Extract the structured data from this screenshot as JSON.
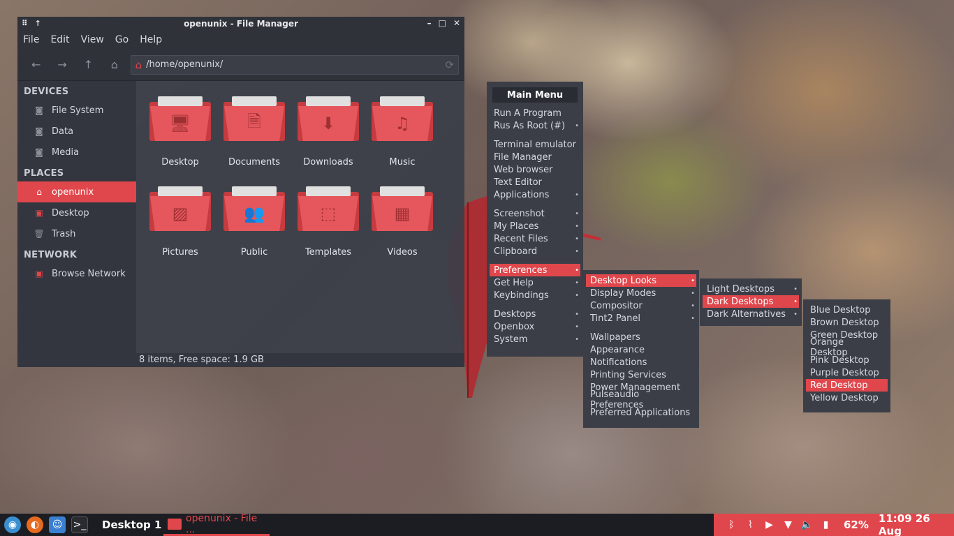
{
  "window": {
    "title": "openunix - File Manager",
    "menu": [
      "File",
      "Edit",
      "View",
      "Go",
      "Help"
    ],
    "path": "/home/openunix/",
    "status": "8 items, Free space: 1.9 GB"
  },
  "sidebar": {
    "devices_label": "DEVICES",
    "devices": [
      "File System",
      "Data",
      "Media"
    ],
    "places_label": "PLACES",
    "places": [
      "openunix",
      "Desktop",
      "Trash"
    ],
    "network_label": "NETWORK",
    "network": [
      "Browse Network"
    ]
  },
  "folders": [
    {
      "name": "Desktop",
      "icon": "desktop-icon"
    },
    {
      "name": "Documents",
      "icon": "document-icon"
    },
    {
      "name": "Downloads",
      "icon": "download-icon"
    },
    {
      "name": "Music",
      "icon": "music-icon"
    },
    {
      "name": "Pictures",
      "icon": "image-icon"
    },
    {
      "name": "Public",
      "icon": "people-icon"
    },
    {
      "name": "Templates",
      "icon": "template-icon"
    },
    {
      "name": "Videos",
      "icon": "film-icon"
    }
  ],
  "main_menu": {
    "title": "Main Menu",
    "items": [
      "Run A Program",
      "Rus As Root (#)",
      "Terminal emulator",
      "File Manager",
      "Web browser",
      "Text Editor",
      "Applications",
      "Screenshot",
      "My Places",
      "Recent Files",
      "Clipboard",
      "Preferences",
      "Get Help",
      "Keybindings",
      "Desktops",
      "Openbox",
      "System"
    ]
  },
  "prefs_menu": {
    "items": [
      "Desktop Looks",
      "Display Modes",
      "Compositor",
      "Tint2 Panel",
      "Wallpapers",
      "Appearance",
      "Notifications",
      "Printing Services",
      "Power Management",
      "Pulseaudio Preferences",
      "Preferred Applications"
    ]
  },
  "looks_menu": {
    "items": [
      "Light Desktops",
      "Dark Desktops",
      "Dark Alternatives"
    ]
  },
  "dark_menu": {
    "items": [
      "Blue Desktop",
      "Brown Desktop",
      "Green Desktop",
      "Orange Desktop",
      "Pink Desktop",
      "Purple Desktop",
      "Red Desktop",
      "Yellow Desktop"
    ]
  },
  "taskbar": {
    "desktop": "Desktop 1",
    "task": "openunix - File ...",
    "battery": "62%",
    "clock": "11:09 26 Aug"
  },
  "colors": {
    "accent": "#e0474c",
    "panel": "#3b3e47",
    "taskbar": "#1c1d22"
  }
}
